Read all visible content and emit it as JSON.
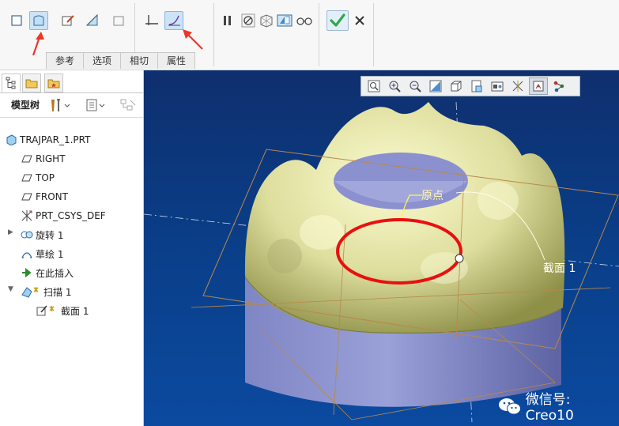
{
  "ribbon": {
    "tabs": [
      "参考",
      "选项",
      "相切",
      "属性"
    ],
    "buttons": {
      "solid": "solid-icon",
      "surface": "surface-icon",
      "sketch": "sketch-icon",
      "remove_material": "remove-material-icon",
      "thin": "thin-icon",
      "constant_section": "constant-section-icon",
      "variable_section": "variable-section-icon",
      "pause": "pause-icon",
      "no_preview": "no-preview-icon",
      "preview_mesh": "preview-mesh-icon",
      "preview_check": "preview-check-icon",
      "glasses": "verify-preview-icon",
      "ok": "ok-check-icon",
      "cancel": "cancel-x-icon"
    },
    "annotation_color": "#e8382a"
  },
  "panel": {
    "title": "模型树",
    "tree": [
      {
        "label": "TRAJPAR_1.PRT",
        "icon": "part-icon"
      },
      {
        "label": "RIGHT",
        "icon": "datum-plane-icon"
      },
      {
        "label": "TOP",
        "icon": "datum-plane-icon"
      },
      {
        "label": "FRONT",
        "icon": "datum-plane-icon"
      },
      {
        "label": "PRT_CSYS_DEF",
        "icon": "csys-icon"
      },
      {
        "label": "旋转 1",
        "icon": "revolve-icon"
      },
      {
        "label": "草绘 1",
        "icon": "sketch-feature-icon"
      },
      {
        "label": "在此插入",
        "icon": "insert-here-icon"
      },
      {
        "label": "扫描 1",
        "icon": "sweep-icon"
      },
      {
        "label": "截面 1",
        "icon": "section-icon"
      }
    ]
  },
  "viewport": {
    "labels": {
      "origin": "原点",
      "section": "截面 1"
    },
    "toolbar": [
      "refit-icon",
      "zoom-in-icon",
      "zoom-out-icon",
      "repaint-icon",
      "display-style-icon",
      "saved-views-icon",
      "view-manager-icon",
      "datum-display-icon",
      "spin-center-icon",
      "annotation-display-icon"
    ],
    "colors": {
      "body": "#dede9e",
      "trajectory": "#e81010",
      "datum": "#b8894a"
    }
  },
  "watermark": "微信号: Creo10"
}
